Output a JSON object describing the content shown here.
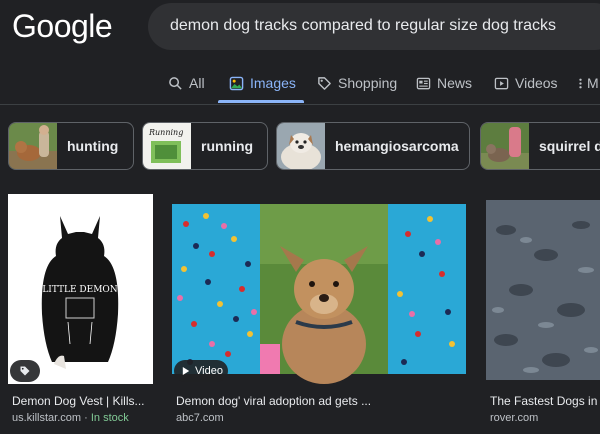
{
  "logo": "Google",
  "search": {
    "query": "demon dog tracks compared to regular size dog tracks"
  },
  "tabs": [
    {
      "label": "All",
      "icon": "search-icon"
    },
    {
      "label": "Images",
      "icon": "image-icon"
    },
    {
      "label": "Shopping",
      "icon": "tag-icon"
    },
    {
      "label": "News",
      "icon": "newspaper-icon"
    },
    {
      "label": "Videos",
      "icon": "play-icon"
    },
    {
      "label": "M",
      "icon": "more-icon"
    }
  ],
  "chips": [
    {
      "label": "hunting"
    },
    {
      "label": "running"
    },
    {
      "label": "hemangiosarcoma"
    },
    {
      "label": "squirrel d"
    }
  ],
  "results": [
    {
      "title": "Demon Dog Vest | Kills...",
      "source": "us.killstar.com",
      "status": "In stock",
      "separator": "·",
      "shirt_text": "LITTLE DEMON"
    },
    {
      "title": "Demon dog' viral adoption ad gets ...",
      "source": "abc7.com",
      "badge": "Video"
    },
    {
      "title": "The Fastest Dogs in",
      "source": "rover.com"
    }
  ],
  "colors": {
    "background": "#202124",
    "accent": "#8ab4f8",
    "in_stock": "#81c995",
    "surface": "#303134"
  }
}
